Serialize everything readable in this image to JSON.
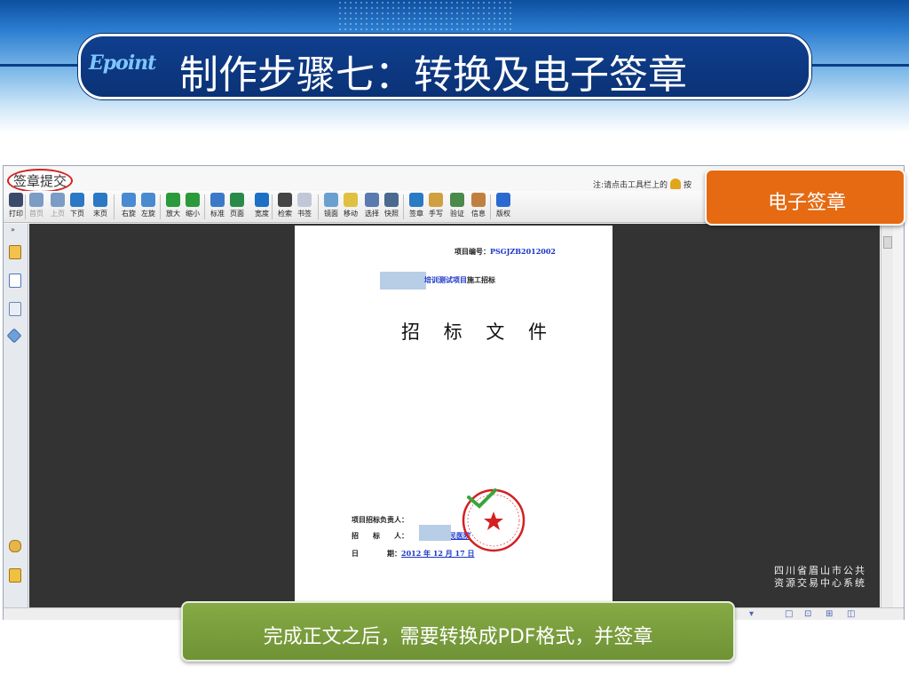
{
  "header": {
    "logo": "Epoint",
    "title": "制作步骤七：转换及电子签章"
  },
  "app": {
    "sign_submit": "签章提交",
    "note": "注:请点击工具栏上的",
    "note_tail": "按",
    "toolbar": [
      {
        "label": "打印",
        "icon": "print-icon"
      },
      {
        "label": "首页",
        "icon": "first-page-icon",
        "disabled": true
      },
      {
        "label": "上页",
        "icon": "prev-page-icon",
        "disabled": true
      },
      {
        "label": "下页",
        "icon": "next-page-icon"
      },
      {
        "label": "末页",
        "icon": "last-page-icon"
      },
      {
        "label": "右旋",
        "icon": "rotate-right-icon"
      },
      {
        "label": "左旋",
        "icon": "rotate-left-icon"
      },
      {
        "label": "放大",
        "icon": "zoom-in-icon"
      },
      {
        "label": "缩小",
        "icon": "zoom-out-icon"
      },
      {
        "label": "标准",
        "icon": "actual-size-icon"
      },
      {
        "label": "页面",
        "icon": "fit-page-icon"
      },
      {
        "label": "宽度",
        "icon": "fit-width-icon"
      },
      {
        "label": "检索",
        "icon": "search-icon"
      },
      {
        "label": "书签",
        "icon": "bookmark-icon"
      },
      {
        "label": "镜面",
        "icon": "magnifier-icon"
      },
      {
        "label": "移动",
        "icon": "hand-icon"
      },
      {
        "label": "选择",
        "icon": "select-text-icon"
      },
      {
        "label": "快照",
        "icon": "snapshot-icon"
      },
      {
        "label": "签章",
        "icon": "stamp-icon"
      },
      {
        "label": "手写",
        "icon": "handwrite-icon"
      },
      {
        "label": "验证",
        "icon": "verify-icon"
      },
      {
        "label": "信息",
        "icon": "info-card-icon"
      },
      {
        "label": "版权",
        "icon": "copyright-icon"
      }
    ]
  },
  "document": {
    "project_no_label": "项目编号：",
    "project_no": "PSGJZB2012002",
    "heading_link": "培训测试项目",
    "heading_rest": "施工招标",
    "title": "招 标 文 件",
    "row1": "项目招标负责人：",
    "row2_label": "招　　标　　人：",
    "row2_value": "人民医院",
    "row3_label": "日　　　　期：",
    "row3_value": "2012 年 12 月 17 日"
  },
  "badge": "电子签章",
  "watermark": [
    "四川省眉山市公共",
    "资源交易中心系统"
  ],
  "caption": "完成正文之后，需要转换成PDF格式，并签章",
  "colors": {
    "badge": "#e56a12",
    "caption": "#7a9b3c",
    "title_bg": "#0b3478",
    "viewer_bg": "#333333"
  }
}
